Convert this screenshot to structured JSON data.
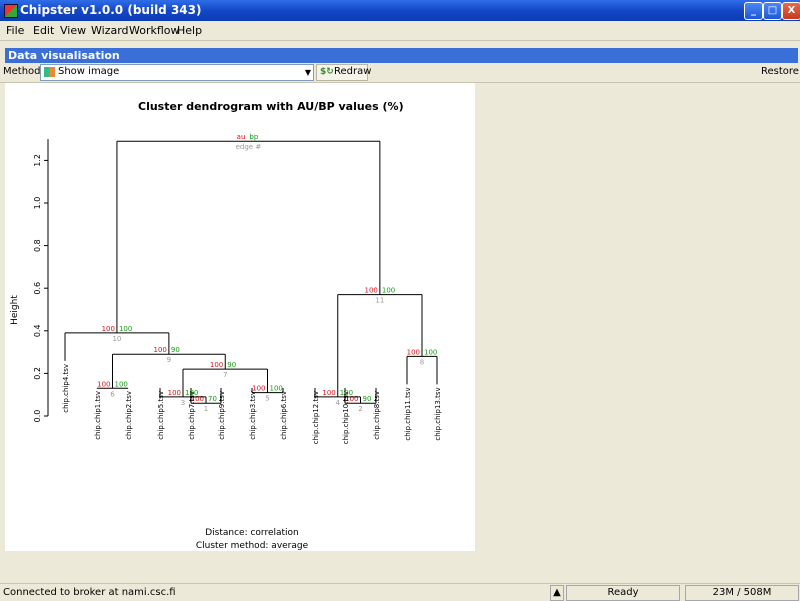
{
  "window": {
    "title": "Chipster v1.0.0 (build 343)",
    "minimize": "_",
    "maximize": "□",
    "close": "X"
  },
  "menu": [
    "File",
    "Edit",
    "View",
    "Wizard",
    "Workflow",
    "Help"
  ],
  "panel": {
    "title": "Data visualisation"
  },
  "toolbar": {
    "method_label": "Method:",
    "method_value": "Show image",
    "redraw_label": "Redraw",
    "restore_label": "Restore"
  },
  "chart_data": {
    "type": "dendrogram",
    "title": "Cluster dendrogram with AU/BP values (%)",
    "ylabel": "Height",
    "ylim": [
      0,
      1.3
    ],
    "yticks": [
      "0.0",
      "0.2",
      "0.4",
      "0.6",
      "0.8",
      "1.0",
      "1.2"
    ],
    "legend": {
      "au": "au",
      "bp": "bp",
      "edge": "edge #"
    },
    "leaves": [
      "chip.chip4.tsv",
      "chip.chip1.tsv",
      "chip.chip2.tsv",
      "chip.chip5.tsv",
      "chip.chip7.tsv",
      "chip.chip9.tsv",
      "chip.chip3.tsv",
      "chip.chip6.tsv",
      "chip.chip12.tsv",
      "chip.chip10.tsv",
      "chip.chip8.tsv",
      "chip.chip11.tsv",
      "chip.chip13.tsv"
    ],
    "merges": [
      {
        "a": [
          1
        ],
        "b": [
          2
        ],
        "height": 0.13,
        "au": "100",
        "bp": "100",
        "edge": "6"
      },
      {
        "a": [
          4
        ],
        "b": [
          5
        ],
        "height": 0.06,
        "au": "100",
        "bp": "70",
        "edge": "1"
      },
      {
        "a": [
          3
        ],
        "b": [
          4,
          5
        ],
        "height": 0.09,
        "au": "100",
        "bp": "100",
        "edge": "3"
      },
      {
        "a": [
          6
        ],
        "b": [
          7
        ],
        "height": 0.11,
        "au": "100",
        "bp": "100",
        "edge": "5"
      },
      {
        "a": [
          3,
          4,
          5
        ],
        "b": [
          6,
          7
        ],
        "height": 0.22,
        "au": "100",
        "bp": "90",
        "edge": "7"
      },
      {
        "a": [
          1,
          2
        ],
        "b": [
          3,
          4,
          5,
          6,
          7
        ],
        "height": 0.29,
        "au": "100",
        "bp": "90",
        "edge": "9"
      },
      {
        "a": [
          0
        ],
        "b": [
          1,
          2,
          3,
          4,
          5,
          6,
          7
        ],
        "height": 0.39,
        "au": "100",
        "bp": "100",
        "edge": "10"
      },
      {
        "a": [
          9
        ],
        "b": [
          10
        ],
        "height": 0.06,
        "au": "100",
        "bp": "90",
        "edge": "2"
      },
      {
        "a": [
          8
        ],
        "b": [
          9,
          10
        ],
        "height": 0.09,
        "au": "100",
        "bp": "100",
        "edge": "4"
      },
      {
        "a": [
          11
        ],
        "b": [
          12
        ],
        "height": 0.28,
        "au": "100",
        "bp": "100",
        "edge": "8"
      },
      {
        "a": [
          8,
          9,
          10
        ],
        "b": [
          11,
          12
        ],
        "height": 0.57,
        "au": "100",
        "bp": "100",
        "edge": "11"
      },
      {
        "a": [
          0,
          1,
          2,
          3,
          4,
          5,
          6,
          7
        ],
        "b": [
          8,
          9,
          10,
          11,
          12
        ],
        "height": 1.29,
        "au": "",
        "bp": "",
        "edge": ""
      }
    ],
    "footer": [
      "Distance:  correlation",
      "Cluster method: average"
    ],
    "colors": {
      "au": "#e01010",
      "bp": "#10a010",
      "edge": "#999999"
    }
  },
  "status": {
    "connection": "Connected to broker at nami.csc.fi",
    "ready": "Ready",
    "memory": "23M / 508M"
  }
}
